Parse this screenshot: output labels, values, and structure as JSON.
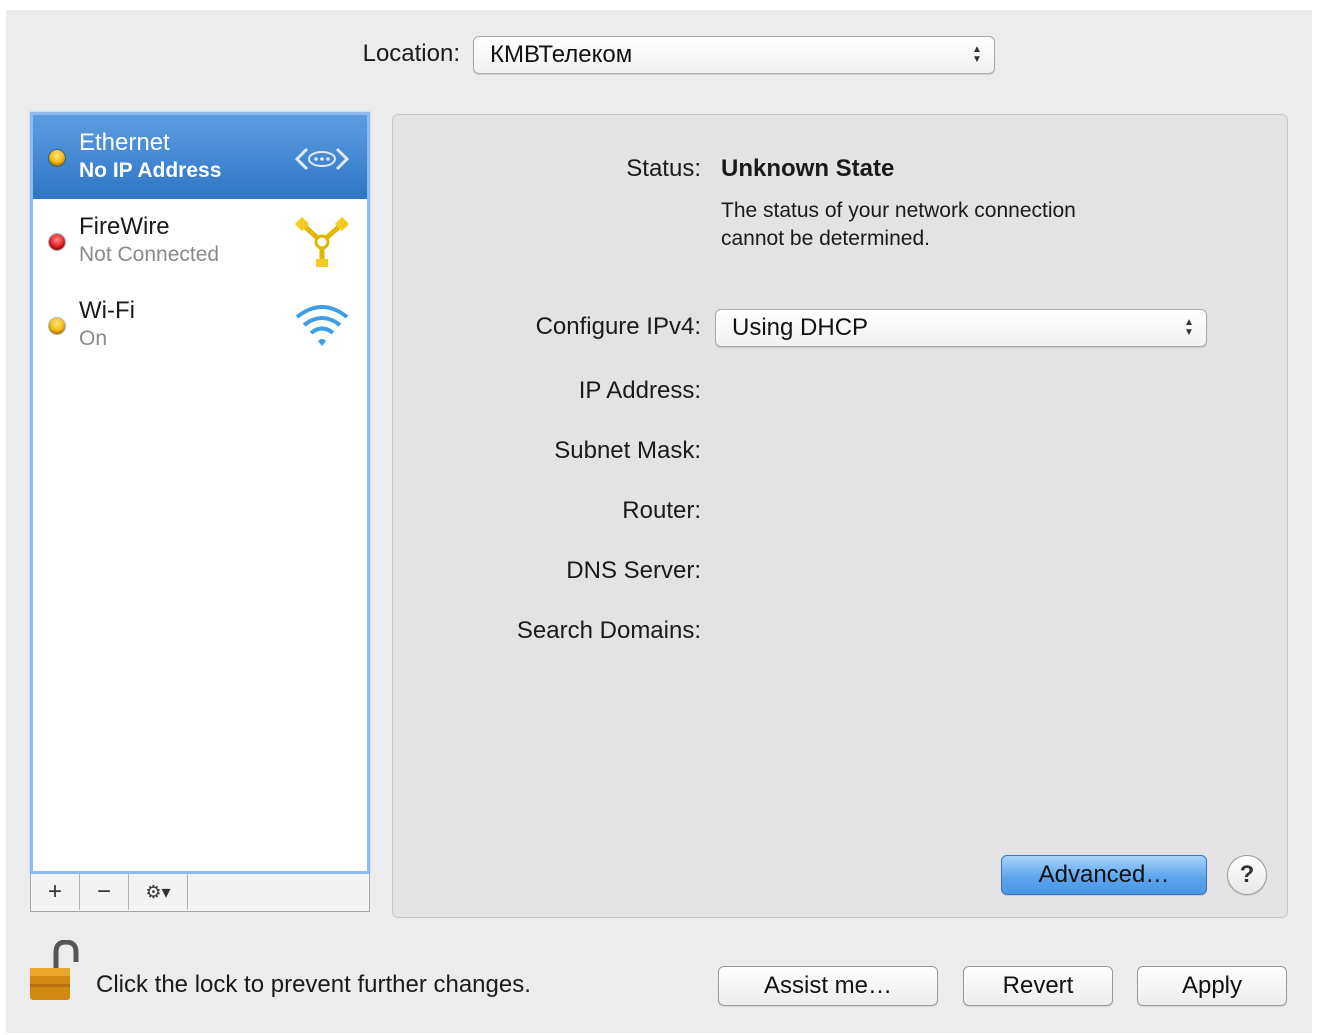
{
  "location": {
    "label": "Location:",
    "value": "КМВТелеком"
  },
  "services": [
    {
      "name": "Ethernet",
      "status": "No IP Address",
      "dot": "yellow",
      "icon": "ethernet-icon",
      "selected": true
    },
    {
      "name": "FireWire",
      "status": "Not Connected",
      "dot": "red",
      "icon": "firewire-icon",
      "selected": false
    },
    {
      "name": "Wi-Fi",
      "status": "On",
      "dot": "yellow",
      "icon": "wifi-icon",
      "selected": false
    }
  ],
  "toolbar": {
    "add": "+",
    "remove": "−",
    "action": "⚙▾"
  },
  "detail": {
    "status_label": "Status:",
    "status_value": "Unknown State",
    "status_desc_line1": "The status of your network connection",
    "status_desc_line2": "cannot be determined.",
    "configure_label": "Configure IPv4:",
    "configure_value": "Using DHCP",
    "ip_label": "IP Address:",
    "subnet_label": "Subnet Mask:",
    "router_label": "Router:",
    "dns_label": "DNS Server:",
    "search_label": "Search Domains:",
    "advanced_button": "Advanced…",
    "help_button": "?"
  },
  "footer": {
    "lock_text": "Click the lock to prevent further changes.",
    "assist_button": "Assist me…",
    "revert_button": "Revert",
    "apply_button": "Apply"
  },
  "colors": {
    "selection": "#3f86d6",
    "dot_yellow": "#f5b400",
    "dot_red": "#e0141a",
    "default_button": "#5fa6ee"
  }
}
